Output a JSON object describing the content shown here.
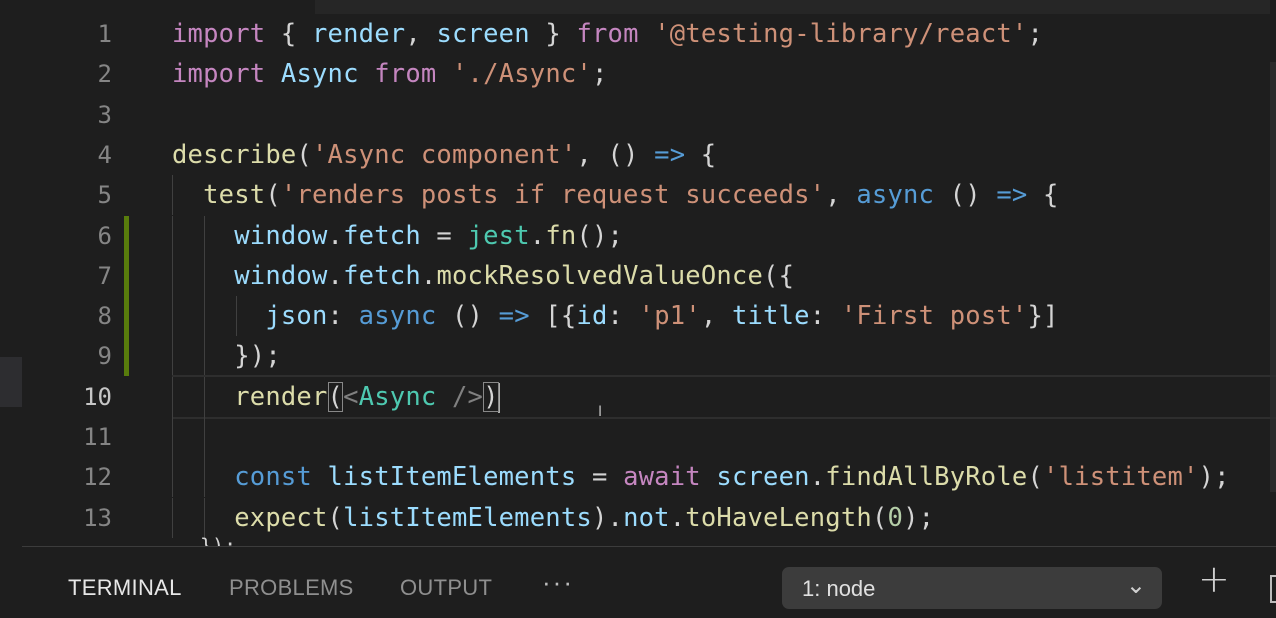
{
  "editor": {
    "active_line": 10,
    "lines": [
      {
        "n": "1",
        "mod": false,
        "tokens": [
          [
            "kw",
            "import"
          ],
          [
            "pn",
            " { "
          ],
          [
            "vr",
            "render"
          ],
          [
            "pn",
            ", "
          ],
          [
            "vr",
            "screen"
          ],
          [
            "pn",
            " } "
          ],
          [
            "kw",
            "from"
          ],
          [
            "pn",
            " "
          ],
          [
            "st",
            "'@testing-library/react'"
          ],
          [
            "pn",
            ";"
          ]
        ]
      },
      {
        "n": "2",
        "mod": false,
        "tokens": [
          [
            "kw",
            "import"
          ],
          [
            "pn",
            " "
          ],
          [
            "vr",
            "Async"
          ],
          [
            "pn",
            " "
          ],
          [
            "kw",
            "from"
          ],
          [
            "pn",
            " "
          ],
          [
            "st",
            "'./Async'"
          ],
          [
            "pn",
            ";"
          ]
        ]
      },
      {
        "n": "3",
        "mod": false,
        "tokens": []
      },
      {
        "n": "4",
        "mod": false,
        "tokens": [
          [
            "fn",
            "describe"
          ],
          [
            "pn",
            "("
          ],
          [
            "st",
            "'Async component'"
          ],
          [
            "pn",
            ", () "
          ],
          [
            "bl",
            "=>"
          ],
          [
            "pn",
            " {"
          ]
        ]
      },
      {
        "n": "5",
        "mod": false,
        "tokens": [
          [
            "pn",
            "  "
          ],
          [
            "fn",
            "test"
          ],
          [
            "pn",
            "("
          ],
          [
            "st",
            "'renders posts if request succeeds'"
          ],
          [
            "pn",
            ", "
          ],
          [
            "bl",
            "async"
          ],
          [
            "pn",
            " () "
          ],
          [
            "bl",
            "=>"
          ],
          [
            "pn",
            " {"
          ]
        ]
      },
      {
        "n": "6",
        "mod": true,
        "tokens": [
          [
            "pn",
            "    "
          ],
          [
            "vr",
            "window"
          ],
          [
            "pn",
            "."
          ],
          [
            "vr",
            "fetch"
          ],
          [
            "pn",
            " = "
          ],
          [
            "ty",
            "jest"
          ],
          [
            "pn",
            "."
          ],
          [
            "fn",
            "fn"
          ],
          [
            "pn",
            "();"
          ]
        ]
      },
      {
        "n": "7",
        "mod": true,
        "tokens": [
          [
            "pn",
            "    "
          ],
          [
            "vr",
            "window"
          ],
          [
            "pn",
            "."
          ],
          [
            "vr",
            "fetch"
          ],
          [
            "pn",
            "."
          ],
          [
            "fn",
            "mockResolvedValueOnce"
          ],
          [
            "pn",
            "({"
          ]
        ]
      },
      {
        "n": "8",
        "mod": true,
        "tokens": [
          [
            "pn",
            "      "
          ],
          [
            "vr",
            "json"
          ],
          [
            "pn",
            ": "
          ],
          [
            "bl",
            "async"
          ],
          [
            "pn",
            " () "
          ],
          [
            "bl",
            "=>"
          ],
          [
            "pn",
            " [{"
          ],
          [
            "vr",
            "id"
          ],
          [
            "pn",
            ": "
          ],
          [
            "st",
            "'p1'"
          ],
          [
            "pn",
            ", "
          ],
          [
            "vr",
            "title"
          ],
          [
            "pn",
            ": "
          ],
          [
            "st",
            "'First post'"
          ],
          [
            "pn",
            "}]"
          ]
        ]
      },
      {
        "n": "9",
        "mod": true,
        "tokens": [
          [
            "pn",
            "    });"
          ]
        ]
      },
      {
        "n": "10",
        "mod": false,
        "tokens": [
          [
            "pn",
            "    "
          ],
          [
            "fn",
            "render"
          ],
          [
            "br",
            "("
          ],
          [
            "tg",
            "<"
          ],
          [
            "ty",
            "Async"
          ],
          [
            "pn",
            " "
          ],
          [
            "tg",
            "/>"
          ],
          [
            "br",
            ")"
          ],
          [
            "cur",
            ""
          ]
        ]
      },
      {
        "n": "11",
        "mod": false,
        "tokens": []
      },
      {
        "n": "12",
        "mod": false,
        "tokens": [
          [
            "pn",
            "    "
          ],
          [
            "bl",
            "const"
          ],
          [
            "pn",
            " "
          ],
          [
            "vr",
            "listItemElements"
          ],
          [
            "pn",
            " = "
          ],
          [
            "kw",
            "await"
          ],
          [
            "pn",
            " "
          ],
          [
            "vr",
            "screen"
          ],
          [
            "pn",
            "."
          ],
          [
            "fn",
            "findAllByRole"
          ],
          [
            "pn",
            "("
          ],
          [
            "st",
            "'listitem'"
          ],
          [
            "pn",
            ");"
          ]
        ]
      },
      {
        "n": "13",
        "mod": false,
        "tokens": [
          [
            "pn",
            "    "
          ],
          [
            "fn",
            "expect"
          ],
          [
            "pn",
            "("
          ],
          [
            "vr",
            "listItemElements"
          ],
          [
            "pn",
            ")."
          ],
          [
            "vr",
            "not"
          ],
          [
            "pn",
            "."
          ],
          [
            "fn",
            "toHaveLength"
          ],
          [
            "pn",
            "("
          ],
          [
            "nm",
            "0"
          ],
          [
            "pn",
            ");"
          ]
        ]
      }
    ],
    "partial_next_line": "});"
  },
  "panel": {
    "tabs": [
      {
        "label": "TERMINAL",
        "active": true
      },
      {
        "label": "PROBLEMS",
        "active": false
      },
      {
        "label": "OUTPUT",
        "active": false
      }
    ],
    "more_label": "···",
    "terminal_select": {
      "value": "1: node"
    },
    "chevron_icon": "chevron-down-icon",
    "add_icon": "plus-icon"
  },
  "colors": {
    "keyword": "#c586c0",
    "string": "#ce9178",
    "variable": "#9cdcfe",
    "function": "#dcdcaa",
    "storage": "#569cd6",
    "type": "#4ec9b0",
    "number": "#b5cea8",
    "modified_gutter": "#587c0c"
  }
}
